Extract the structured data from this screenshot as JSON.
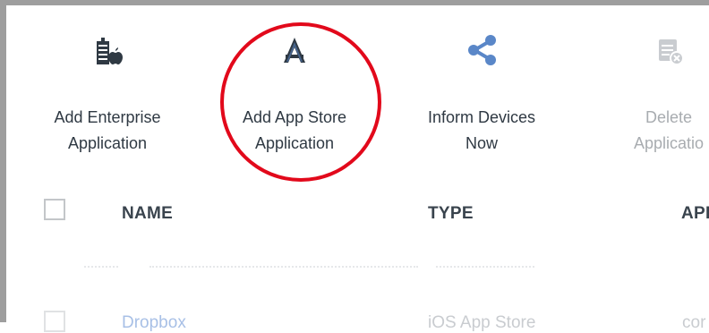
{
  "toolbar": {
    "add_enterprise": {
      "line1": "Add Enterprise",
      "line2": "Application",
      "icon": "add-enterprise-app-icon"
    },
    "add_app_store": {
      "line1": "Add App Store",
      "line2": "Application",
      "icon": "app-store-icon"
    },
    "inform_devices": {
      "line1": "Inform Devices",
      "line2": "Now",
      "icon": "share-icon"
    },
    "delete_app": {
      "line1": "Delete",
      "line2": "Applicatio",
      "icon": "delete-app-icon",
      "disabled": true
    }
  },
  "table": {
    "headers": [
      "NAME",
      "TYPE",
      "API"
    ],
    "rows": [
      {
        "name": "Dropbox",
        "type": "iOS App Store",
        "api": "cor"
      }
    ]
  },
  "colors": {
    "accent_blue": "#5a87c8",
    "highlight_red": "#e2091b",
    "text_dark": "#2f3943",
    "disabled_gray": "#a8acb0"
  }
}
